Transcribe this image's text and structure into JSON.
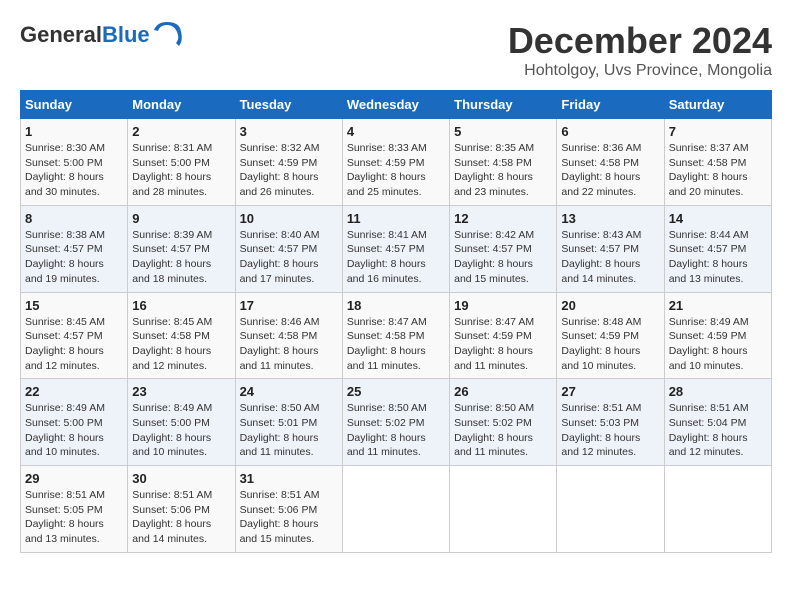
{
  "logo": {
    "general": "General",
    "blue": "Blue"
  },
  "title": "December 2024",
  "location": "Hohtolgoy, Uvs Province, Mongolia",
  "days_of_week": [
    "Sunday",
    "Monday",
    "Tuesday",
    "Wednesday",
    "Thursday",
    "Friday",
    "Saturday"
  ],
  "weeks": [
    [
      {
        "day": "1",
        "sunrise": "8:30 AM",
        "sunset": "5:00 PM",
        "daylight": "8 hours and 30 minutes."
      },
      {
        "day": "2",
        "sunrise": "8:31 AM",
        "sunset": "5:00 PM",
        "daylight": "8 hours and 28 minutes."
      },
      {
        "day": "3",
        "sunrise": "8:32 AM",
        "sunset": "4:59 PM",
        "daylight": "8 hours and 26 minutes."
      },
      {
        "day": "4",
        "sunrise": "8:33 AM",
        "sunset": "4:59 PM",
        "daylight": "8 hours and 25 minutes."
      },
      {
        "day": "5",
        "sunrise": "8:35 AM",
        "sunset": "4:58 PM",
        "daylight": "8 hours and 23 minutes."
      },
      {
        "day": "6",
        "sunrise": "8:36 AM",
        "sunset": "4:58 PM",
        "daylight": "8 hours and 22 minutes."
      },
      {
        "day": "7",
        "sunrise": "8:37 AM",
        "sunset": "4:58 PM",
        "daylight": "8 hours and 20 minutes."
      }
    ],
    [
      {
        "day": "8",
        "sunrise": "8:38 AM",
        "sunset": "4:57 PM",
        "daylight": "8 hours and 19 minutes."
      },
      {
        "day": "9",
        "sunrise": "8:39 AM",
        "sunset": "4:57 PM",
        "daylight": "8 hours and 18 minutes."
      },
      {
        "day": "10",
        "sunrise": "8:40 AM",
        "sunset": "4:57 PM",
        "daylight": "8 hours and 17 minutes."
      },
      {
        "day": "11",
        "sunrise": "8:41 AM",
        "sunset": "4:57 PM",
        "daylight": "8 hours and 16 minutes."
      },
      {
        "day": "12",
        "sunrise": "8:42 AM",
        "sunset": "4:57 PM",
        "daylight": "8 hours and 15 minutes."
      },
      {
        "day": "13",
        "sunrise": "8:43 AM",
        "sunset": "4:57 PM",
        "daylight": "8 hours and 14 minutes."
      },
      {
        "day": "14",
        "sunrise": "8:44 AM",
        "sunset": "4:57 PM",
        "daylight": "8 hours and 13 minutes."
      }
    ],
    [
      {
        "day": "15",
        "sunrise": "8:45 AM",
        "sunset": "4:57 PM",
        "daylight": "8 hours and 12 minutes."
      },
      {
        "day": "16",
        "sunrise": "8:45 AM",
        "sunset": "4:58 PM",
        "daylight": "8 hours and 12 minutes."
      },
      {
        "day": "17",
        "sunrise": "8:46 AM",
        "sunset": "4:58 PM",
        "daylight": "8 hours and 11 minutes."
      },
      {
        "day": "18",
        "sunrise": "8:47 AM",
        "sunset": "4:58 PM",
        "daylight": "8 hours and 11 minutes."
      },
      {
        "day": "19",
        "sunrise": "8:47 AM",
        "sunset": "4:59 PM",
        "daylight": "8 hours and 11 minutes."
      },
      {
        "day": "20",
        "sunrise": "8:48 AM",
        "sunset": "4:59 PM",
        "daylight": "8 hours and 10 minutes."
      },
      {
        "day": "21",
        "sunrise": "8:49 AM",
        "sunset": "4:59 PM",
        "daylight": "8 hours and 10 minutes."
      }
    ],
    [
      {
        "day": "22",
        "sunrise": "8:49 AM",
        "sunset": "5:00 PM",
        "daylight": "8 hours and 10 minutes."
      },
      {
        "day": "23",
        "sunrise": "8:49 AM",
        "sunset": "5:00 PM",
        "daylight": "8 hours and 10 minutes."
      },
      {
        "day": "24",
        "sunrise": "8:50 AM",
        "sunset": "5:01 PM",
        "daylight": "8 hours and 11 minutes."
      },
      {
        "day": "25",
        "sunrise": "8:50 AM",
        "sunset": "5:02 PM",
        "daylight": "8 hours and 11 minutes."
      },
      {
        "day": "26",
        "sunrise": "8:50 AM",
        "sunset": "5:02 PM",
        "daylight": "8 hours and 11 minutes."
      },
      {
        "day": "27",
        "sunrise": "8:51 AM",
        "sunset": "5:03 PM",
        "daylight": "8 hours and 12 minutes."
      },
      {
        "day": "28",
        "sunrise": "8:51 AM",
        "sunset": "5:04 PM",
        "daylight": "8 hours and 12 minutes."
      }
    ],
    [
      {
        "day": "29",
        "sunrise": "8:51 AM",
        "sunset": "5:05 PM",
        "daylight": "8 hours and 13 minutes."
      },
      {
        "day": "30",
        "sunrise": "8:51 AM",
        "sunset": "5:06 PM",
        "daylight": "8 hours and 14 minutes."
      },
      {
        "day": "31",
        "sunrise": "8:51 AM",
        "sunset": "5:06 PM",
        "daylight": "8 hours and 15 minutes."
      },
      null,
      null,
      null,
      null
    ]
  ]
}
